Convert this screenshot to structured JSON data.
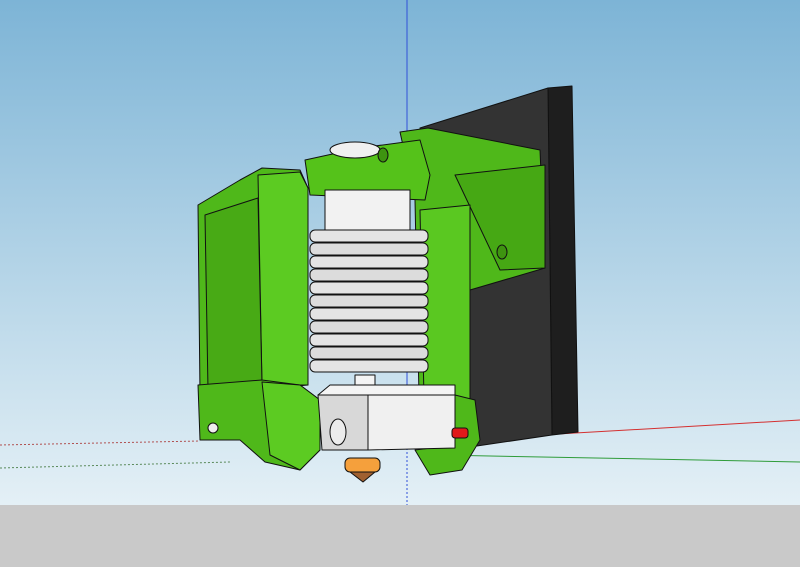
{
  "viewport": {
    "kind": "3d-model-viewport",
    "model": "hotend-mount-assembly",
    "colors": {
      "sky_top": "#7db4d6",
      "sky_horizon": "#e4f0f6",
      "ground": "#c9c9c9",
      "body_green": "#55c21a",
      "body_green_dark": "#3f9a10",
      "plate_black": "#333333",
      "heatsink": "#e2e2e2",
      "nozzle": "#f5a03c",
      "axis_red": "#d43030",
      "axis_green": "#2f9c3a",
      "axis_blue": "#3050d8"
    }
  }
}
